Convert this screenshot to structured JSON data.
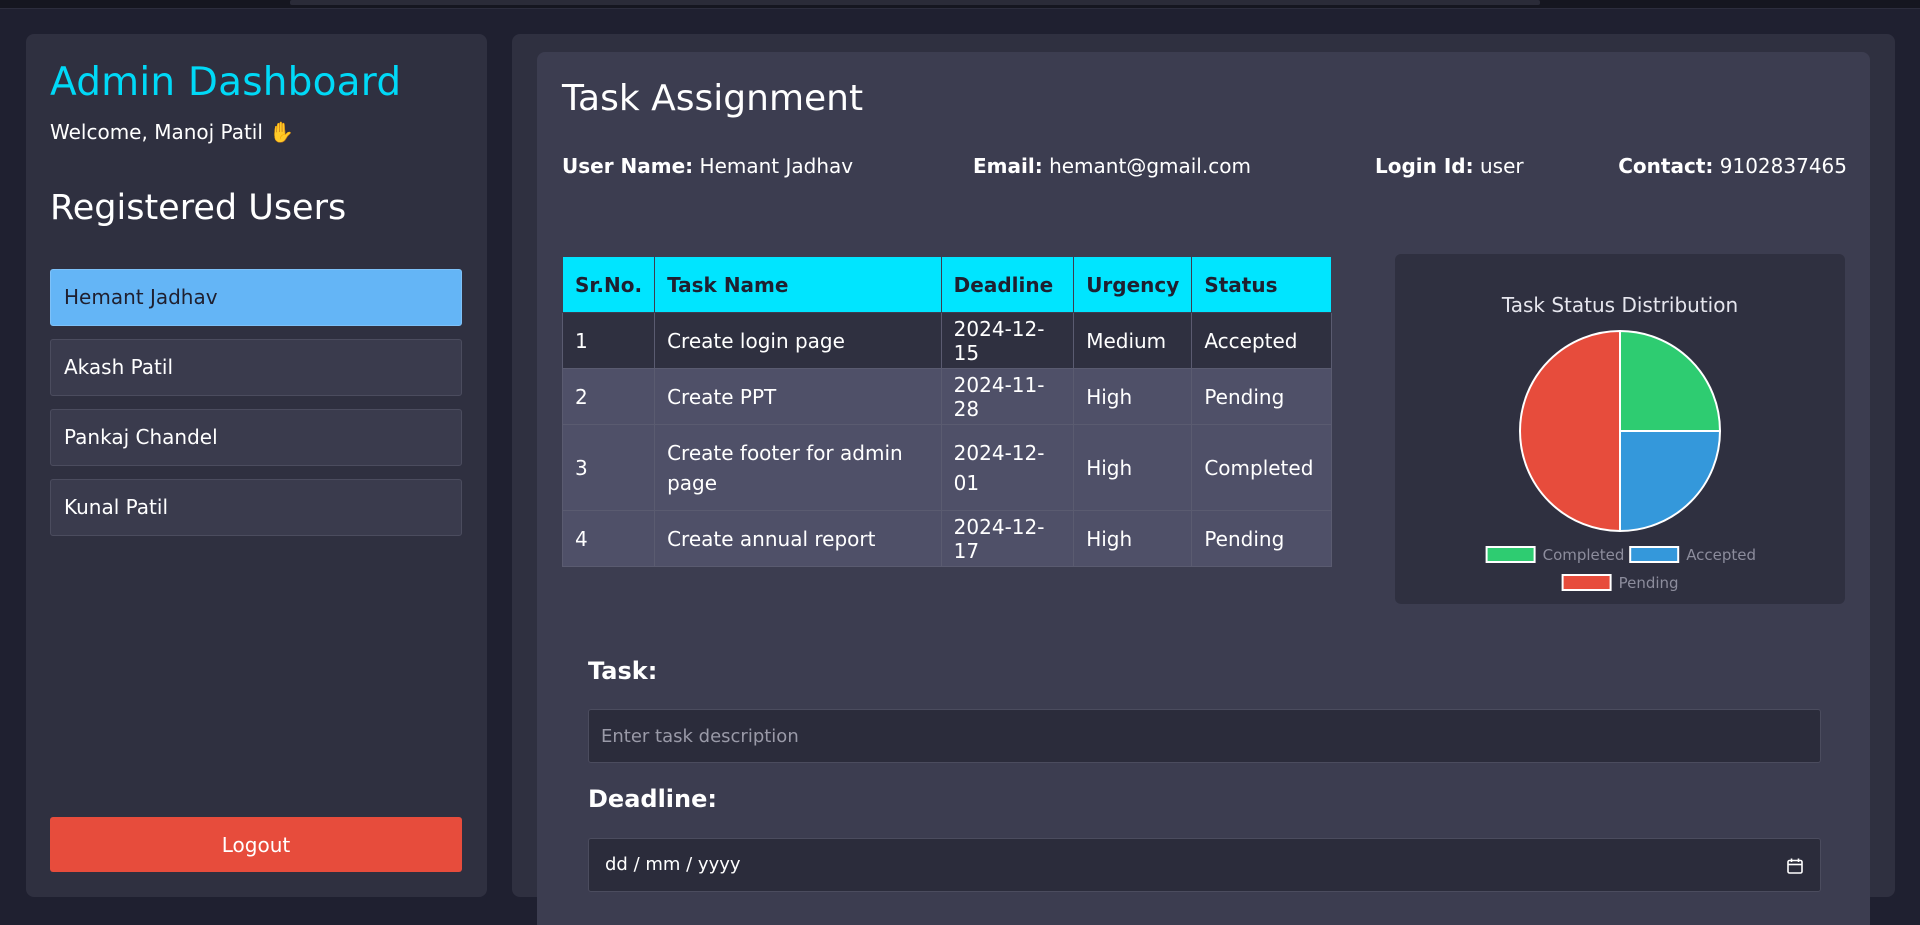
{
  "sidebar": {
    "brand": "Admin Dashboard",
    "welcome": "Welcome, Manoj Patil ✋",
    "registered_title": "Registered Users",
    "users": [
      {
        "name": "Hemant Jadhav",
        "active": true
      },
      {
        "name": "Akash Patil",
        "active": false
      },
      {
        "name": "Pankaj Chandel",
        "active": false
      },
      {
        "name": "Kunal Patil",
        "active": false
      }
    ],
    "logout_label": "Logout"
  },
  "main": {
    "title": "Task Assignment",
    "info": {
      "username_label": "User Name:",
      "username": "Hemant Jadhav",
      "email_label": "Email:",
      "email": "hemant@gmail.com",
      "login_label": "Login Id:",
      "login_id": "user",
      "contact_label": "Contact:",
      "contact": "9102837465"
    },
    "table": {
      "headers": [
        "Sr.No.",
        "Task Name",
        "Deadline",
        "Urgency",
        "Status"
      ],
      "rows": [
        [
          "1",
          "Create login page",
          "2024-12-15",
          "Medium",
          "Accepted"
        ],
        [
          "2",
          "Create PPT",
          "2024-11-28",
          "High",
          "Pending"
        ],
        [
          "3",
          "Create footer for admin page",
          "2024-12-01",
          "High",
          "Completed"
        ],
        [
          "4",
          "Create annual report",
          "2024-12-17",
          "High",
          "Pending"
        ]
      ]
    },
    "form": {
      "task_label": "Task:",
      "task_placeholder": "Enter task description",
      "deadline_label": "Deadline:",
      "deadline_placeholder": "dd / mm / yyyy"
    }
  },
  "chart_data": {
    "type": "pie",
    "title": "Task Status Distribution",
    "categories": [
      "Completed",
      "Accepted",
      "Pending"
    ],
    "values": [
      1,
      1,
      2
    ],
    "colors": [
      "#2ecc71",
      "#3498db",
      "#e74c3c"
    ],
    "legend": "bottom"
  },
  "colors": {
    "accent": "#00d9f7",
    "table_header": "#00e5ff",
    "active_user": "#64b5f6",
    "logout": "#e74c3c"
  }
}
